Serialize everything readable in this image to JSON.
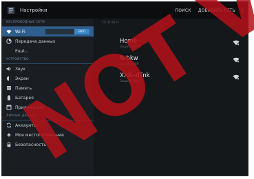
{
  "action_bar": {
    "title": "Настройки",
    "actions": [
      "ПОИСК",
      "ДОБАВИТЬ СЕТЬ"
    ],
    "icons": [
      "settings-app-icon",
      "overflow-menu-icon"
    ]
  },
  "sidebar": {
    "sections": [
      {
        "header": "БЕСПРОВОДНЫЕ СЕТИ",
        "items": [
          {
            "label": "Wi-Fi",
            "icon": "wifi-icon",
            "selected": true,
            "toggle": {
              "on_label": "ВКЛ"
            }
          },
          {
            "label": "Передача данных",
            "icon": "data-usage-icon",
            "selected": false
          },
          {
            "label": "Ещё...",
            "icon": "",
            "selected": false
          }
        ]
      },
      {
        "header": "УСТРОЙСТВО",
        "items": [
          {
            "label": "Звук",
            "icon": "sound-icon",
            "selected": false
          },
          {
            "label": "Экран",
            "icon": "display-icon",
            "selected": false
          },
          {
            "label": "Память",
            "icon": "storage-icon",
            "selected": false
          },
          {
            "label": "Батарея",
            "icon": "battery-icon",
            "selected": false
          },
          {
            "label": "Приложения",
            "icon": "apps-icon",
            "selected": false
          }
        ]
      },
      {
        "header": "ЛИЧНЫЕ ДАННЫЕ",
        "items": [
          {
            "label": "Аккаунты",
            "icon": "sync-icon",
            "selected": false
          },
          {
            "label": "Мое местоположение",
            "icon": "location-icon",
            "selected": false
          },
          {
            "label": "Безопасность",
            "icon": "lock-icon",
            "selected": false
          }
        ]
      }
    ]
  },
  "main": {
    "header": "СЕТИ Wi-Fi",
    "networks": [
      {
        "name": "Home",
        "status": "Защита WPA2",
        "icon": "wifi-signal-lock-icon"
      },
      {
        "name": "N-bkw",
        "status": "Защита WEP",
        "icon": "wifi-signal-lock-icon"
      },
      {
        "name": "XXX--dlink",
        "status": "Защита WPA2",
        "icon": "wifi-signal-lock-icon"
      }
    ]
  },
  "watermark": {
    "text": "NOT V",
    "color": "#b3121a"
  },
  "colors": {
    "accent": "#3a88c8",
    "selected_bg": "#2f5f8e"
  }
}
